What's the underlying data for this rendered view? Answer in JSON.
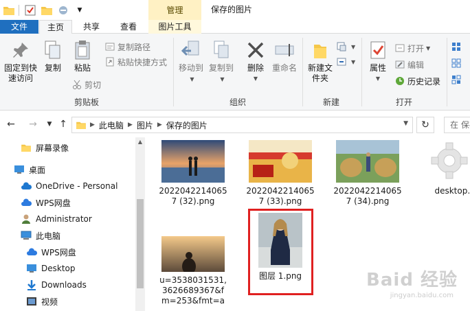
{
  "title_bar": {
    "manage_label": "管理",
    "window_title": "保存的图片"
  },
  "tabs": {
    "file": "文件",
    "home": "主页",
    "share": "共享",
    "view": "查看",
    "picture_tools": "图片工具"
  },
  "ribbon": {
    "clipboard": {
      "pin": "固定到快速访问",
      "copy": "复制",
      "paste": "粘贴",
      "copy_path": "复制路径",
      "paste_shortcut": "粘贴快捷方式",
      "cut": "剪切",
      "label": "剪贴板"
    },
    "organize": {
      "move_to": "移动到",
      "copy_to": "复制到",
      "delete": "删除",
      "rename": "重命名",
      "label": "组织"
    },
    "new": {
      "new_folder": "新建文件夹",
      "label": "新建"
    },
    "open": {
      "properties": "属性",
      "open": "打开",
      "edit": "编辑",
      "history": "历史记录",
      "label": "打开"
    }
  },
  "address": {
    "crumbs": [
      "此电脑",
      "图片",
      "保存的图片"
    ],
    "search_placeholder": "在 保存"
  },
  "nav": {
    "items": [
      {
        "label": "屏幕录像",
        "icon": "folder-icon"
      },
      {
        "label": "桌面",
        "icon": "desktop-icon"
      },
      {
        "label": "OneDrive - Personal",
        "icon": "cloud-icon"
      },
      {
        "label": "WPS网盘",
        "icon": "cloud-icon"
      },
      {
        "label": "Administrator",
        "icon": "user-icon"
      },
      {
        "label": "此电脑",
        "icon": "computer-icon"
      },
      {
        "label": "WPS网盘",
        "icon": "cloud-icon"
      },
      {
        "label": "Desktop",
        "icon": "desktop-icon"
      },
      {
        "label": "Downloads",
        "icon": "download-icon"
      },
      {
        "label": "视频",
        "icon": "video-icon"
      }
    ]
  },
  "files": [
    {
      "name": "20220422140657 (32).png"
    },
    {
      "name": "20220422140657 (33).png"
    },
    {
      "name": "20220422140657 (34).png"
    },
    {
      "name": "desktop.i"
    },
    {
      "name": "u=3538031531,3626689367&fm=253&fmt=a"
    },
    {
      "name": "图层 1.png"
    }
  ],
  "watermark": {
    "text": "Baid 经验",
    "sub": "jingyan.baidu.com"
  },
  "colors": {
    "accent": "#1f6fbf",
    "manage_tab": "#fff1c4",
    "selection_frame": "#e02020"
  }
}
